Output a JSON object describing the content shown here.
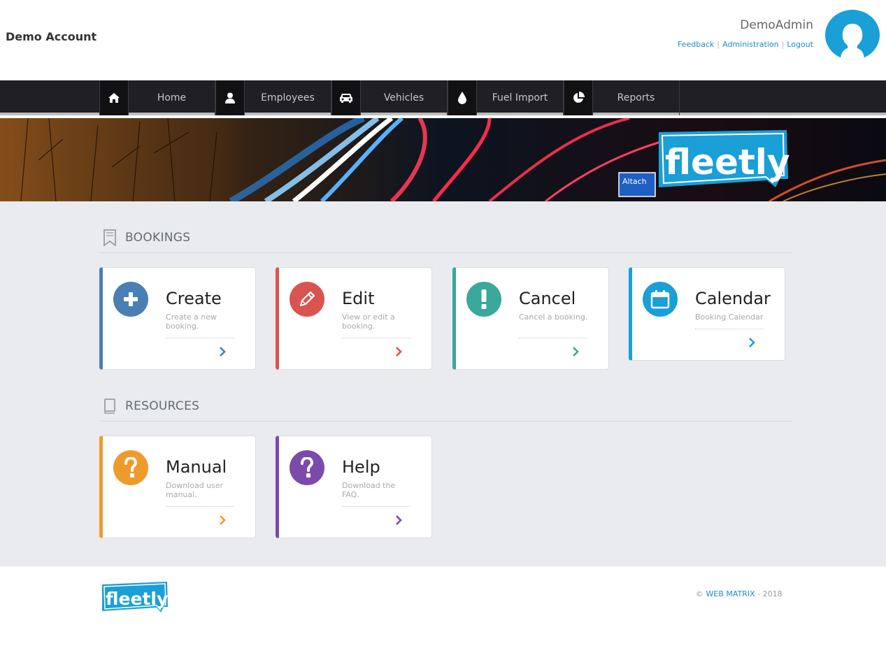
{
  "header": {
    "account_name": "Demo Account",
    "user_name": "DemoAdmin",
    "links": [
      "Feedback",
      "Administration",
      "Logout"
    ],
    "separator": "|"
  },
  "nav": {
    "items": [
      {
        "label": "Home",
        "icon": "home-icon"
      },
      {
        "label": "Employees",
        "icon": "user-icon"
      },
      {
        "label": "Vehicles",
        "icon": "car-icon"
      },
      {
        "label": "Fuel Import",
        "icon": "fuel-drop-icon"
      },
      {
        "label": "Reports",
        "icon": "pie-chart-icon"
      }
    ]
  },
  "banner": {
    "logo_text": "fleetly",
    "sign_text": "Altach"
  },
  "sections": {
    "bookings": {
      "title": "BOOKINGS",
      "icon": "bookmark-icon",
      "cards": [
        {
          "title": "Create",
          "desc": "Create a new booking.",
          "icon": "plus-icon",
          "color": "#4a7fb5"
        },
        {
          "title": "Edit",
          "desc": "View or edit a booking.",
          "icon": "pencil-icon",
          "color": "#d9534f"
        },
        {
          "title": "Cancel",
          "desc": "Cancel a booking.",
          "icon": "exclamation-icon",
          "color": "#3aa89b"
        },
        {
          "title": "Calendar",
          "desc": "Booking Calendar",
          "icon": "calendar-icon",
          "color": "#1a9fd6"
        }
      ]
    },
    "resources": {
      "title": "RESOURCES",
      "icon": "book-icon",
      "cards": [
        {
          "title": "Manual",
          "desc": "Download user manual.",
          "icon": "question-icon",
          "color": "#ee9b2c"
        },
        {
          "title": "Help",
          "desc": "Download the FAQ.",
          "icon": "question-icon",
          "color": "#7b4aab"
        }
      ]
    }
  },
  "footer": {
    "logo_text": "fleetly",
    "copyright_symbol": "©",
    "brand": "WEB MATRIX",
    "year_text": "- 2018"
  }
}
